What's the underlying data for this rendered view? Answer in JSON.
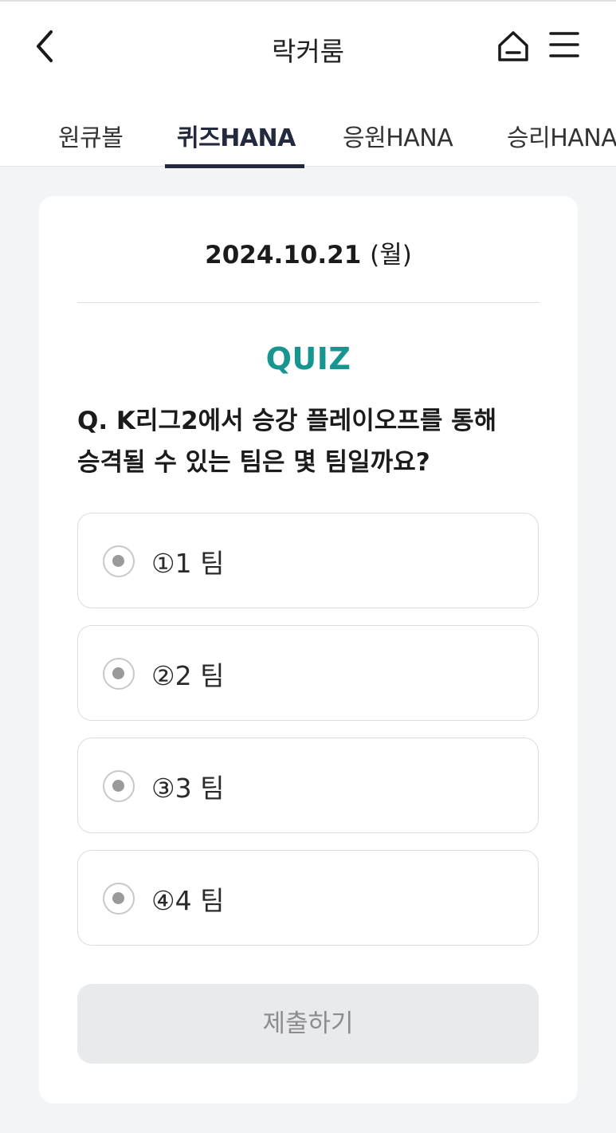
{
  "header": {
    "title": "락커룸",
    "back_icon": "chevron-left-icon",
    "home_icon": "home-icon",
    "menu_icon": "hamburger-menu-icon"
  },
  "tabs": [
    {
      "label": "원큐볼",
      "active": false
    },
    {
      "label": "퀴즈HANA",
      "active": true
    },
    {
      "label": "응원HANA",
      "active": false
    },
    {
      "label": "승리HANA",
      "active": false
    }
  ],
  "quiz": {
    "date": "2024.10.21",
    "day_of_week": "(월)",
    "label": "QUIZ",
    "question_line1": "Q. K리그2에서 승강 플레이오프를 통해",
    "question_line2": "승격될 수 있는 팀은 몇 팀일까요?",
    "options": [
      {
        "label": "①1 팀"
      },
      {
        "label": "②2 팀"
      },
      {
        "label": "③3 팀"
      },
      {
        "label": "④4 팀"
      }
    ],
    "submit_label": "제출하기"
  },
  "colors": {
    "accent": "#179590",
    "active_tab": "#232a3d",
    "background": "#f3f4f6",
    "submit_disabled_bg": "#e9eaed"
  }
}
